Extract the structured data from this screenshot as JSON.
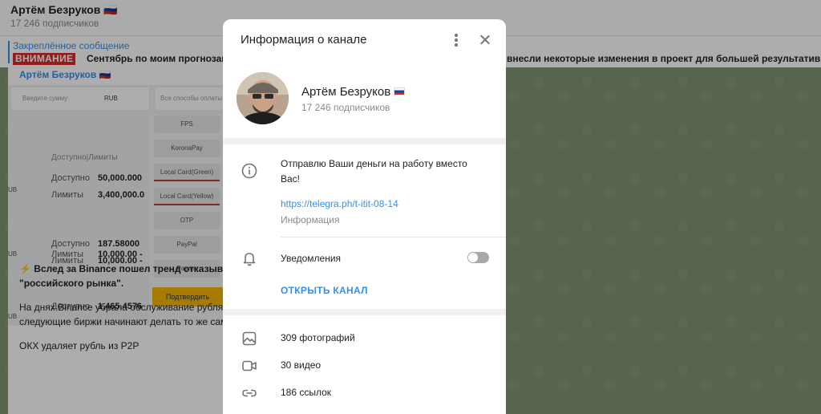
{
  "background": {
    "header": {
      "title": "Артём Безруков 🇷🇺",
      "subtitle": "17 246 подписчиков"
    },
    "pinned": {
      "label": "Закреплённое сообщение",
      "badge": "ВНИМАНИЕ",
      "text": "Сентябрь по моим прогнозам",
      "text_right": "внесли некоторые изменения в проект для большей результативн"
    },
    "message": {
      "author": "Артём Безруков 🇷🇺",
      "embed": {
        "amount_placeholder": "Введите сумму",
        "currency": "RUB",
        "method_placeholder": "Все способы оплаты",
        "col_header": "Доступно|Лимиты",
        "options": [
          "FPS",
          "KoronaPay",
          "Local Card(Green)",
          "Local Card(Yellow)",
          "OTP",
          "PayPal",
          "Payeer"
        ],
        "confirm": "Подтвердить",
        "rows": [
          {
            "currency": "UB",
            "available_label": "Доступно",
            "available": "50,000.000",
            "limits_label": "Лимиты",
            "limits": "3,400,000.0"
          },
          {
            "currency": "UB",
            "available_label": "Доступно",
            "available": "187.58000",
            "limits_label": "Лимиты",
            "limits": "10,000.00 -"
          },
          {
            "currency": "UB",
            "available_label": "Доступно",
            "available": "1,465.4576",
            "limits_label": "Лимиты",
            "limits": "10,000.00 -"
          }
        ]
      },
      "line1": "Вслед за Binance пошел тренд отказыват",
      "line2": "\"российского рынка\".",
      "line3": "На днях Binance убрала обслуживание рубля,",
      "line4": "следующие биржи начинают делать то же сам",
      "line5": "ОКХ удаляет рубль из P2P"
    }
  },
  "dialog": {
    "title": "Информация о канале",
    "channel": {
      "name": "Артём Безруков",
      "subscribers": "17 246 подписчиков"
    },
    "description": "Отправлю Ваши деньги на работу вместо Вас!",
    "link": "https://telegra.ph/t-itit-08-14",
    "link_label": "Информация",
    "notifications_label": "Уведомления",
    "notifications_on": false,
    "open_channel": "ОТКРЫТЬ КАНАЛ",
    "media": [
      {
        "icon": "photo-icon",
        "label": "309 фотографий"
      },
      {
        "icon": "video-icon",
        "label": "30 видео"
      },
      {
        "icon": "link-icon",
        "label": "186 ссылок"
      }
    ],
    "colors": {
      "accent": "#3390ec",
      "badge_red": "#d92a2a"
    }
  }
}
